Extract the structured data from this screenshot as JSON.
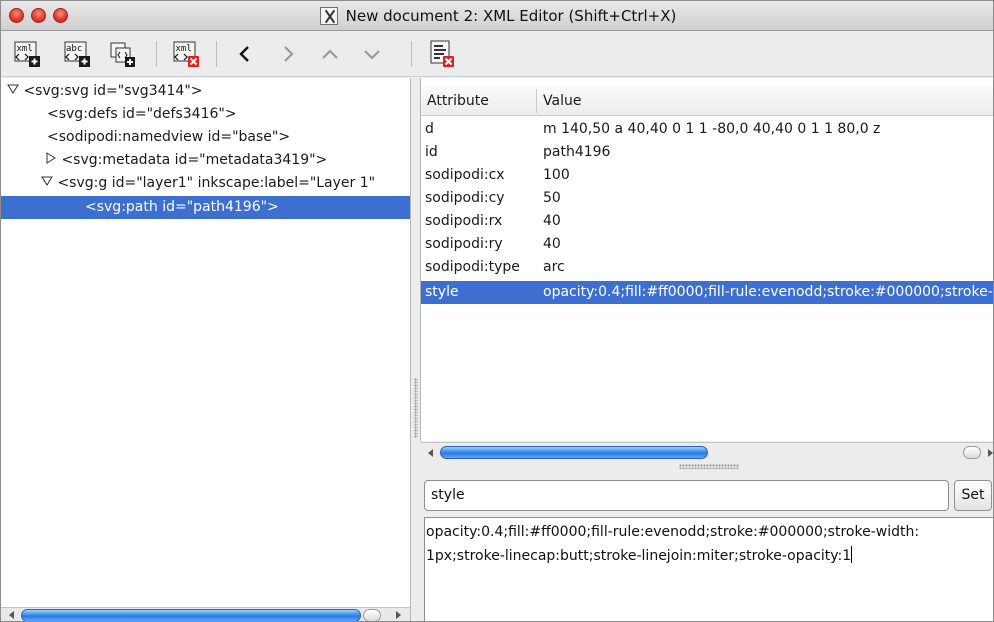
{
  "window": {
    "title": "New document 2: XML Editor (Shift+Ctrl+X)"
  },
  "toolbar": {
    "icons": [
      "new-element-node-icon",
      "new-text-node-icon",
      "duplicate-node-icon",
      "delete-node-icon",
      "unindent-icon",
      "indent-icon",
      "raise-node-icon",
      "lower-node-icon",
      "delete-attribute-icon"
    ],
    "labels": {
      "new_element": "xml",
      "new_text": "abc",
      "delete_node": "xml"
    }
  },
  "tree": {
    "nodes": [
      {
        "label": "<svg:svg id=\"svg3414\">",
        "expander": "expanded"
      },
      {
        "label": "<svg:defs id=\"defs3416\">",
        "expander": "none"
      },
      {
        "label": "<sodipodi:namedview id=\"base\">",
        "expander": "none"
      },
      {
        "label": "<svg:metadata id=\"metadata3419\">",
        "expander": "collapsed"
      },
      {
        "label": "<svg:g id=\"layer1\" inkscape:label=\"Layer 1\"",
        "expander": "expanded"
      },
      {
        "label": "<svg:path id=\"path4196\">",
        "expander": "none",
        "selected": true
      }
    ]
  },
  "attributes": {
    "header": {
      "name": "Attribute",
      "value": "Value"
    },
    "rows": [
      {
        "name": "d",
        "value": "m 140,50 a 40,40 0 1 1 -80,0 40,40 0 1 1 80,0 z"
      },
      {
        "name": "id",
        "value": "path4196"
      },
      {
        "name": "sodipodi:cx",
        "value": "100"
      },
      {
        "name": "sodipodi:cy",
        "value": "50"
      },
      {
        "name": "sodipodi:rx",
        "value": "40"
      },
      {
        "name": "sodipodi:ry",
        "value": "40"
      },
      {
        "name": "sodipodi:type",
        "value": "arc"
      },
      {
        "name": "style",
        "value": "opacity:0.4;fill:#ff0000;fill-rule:evenodd;stroke:#000000;stroke-width:1px",
        "selected": true
      }
    ]
  },
  "editor": {
    "attribute_name": "style",
    "set_label": "Set",
    "attribute_value": "opacity:0.4;fill:#ff0000;fill-rule:evenodd;stroke:#000000;stroke-width:\n1px;stroke-linecap:butt;stroke-linejoin:miter;stroke-opacity:1"
  },
  "colors": {
    "selection": "#3d6fd1",
    "scroll_thumb": "#2b7ae0",
    "traffic_light": "#d42d1e",
    "delete_badge": "#e02020",
    "add_badge": "#1a1a1a"
  }
}
